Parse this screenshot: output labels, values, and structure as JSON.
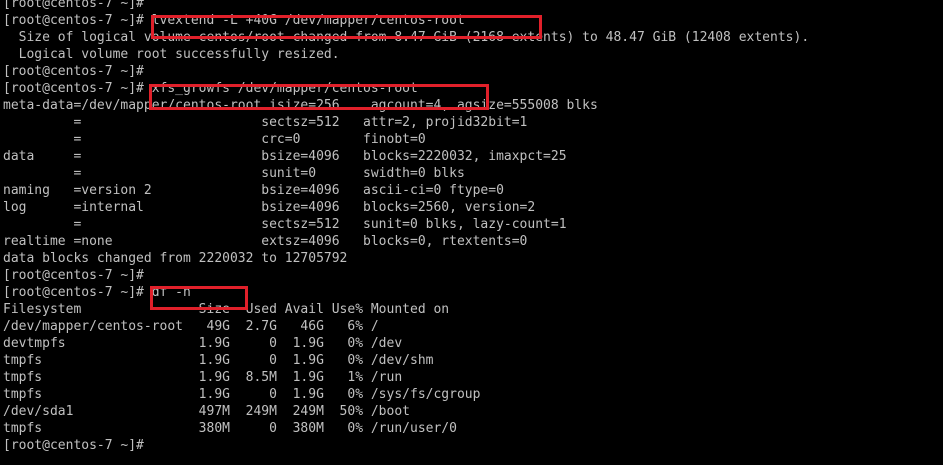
{
  "terminal": {
    "lines": [
      "[root@centos-7 ~]#",
      "[root@centos-7 ~]# lvextend -L +40G /dev/mapper/centos-root",
      "  Size of logical volume centos/root changed from 8.47 GiB (2168 extents) to 48.47 GiB (12408 extents).",
      "  Logical volume root successfully resized.",
      "[root@centos-7 ~]#",
      "[root@centos-7 ~]# xfs_growfs /dev/mapper/centos-root",
      "meta-data=/dev/mapper/centos-root isize=256    agcount=4, agsize=555008 blks",
      "         =                       sectsz=512   attr=2, projid32bit=1",
      "         =                       crc=0        finobt=0",
      "data     =                       bsize=4096   blocks=2220032, imaxpct=25",
      "         =                       sunit=0      swidth=0 blks",
      "naming   =version 2              bsize=4096   ascii-ci=0 ftype=0",
      "log      =internal               bsize=4096   blocks=2560, version=2",
      "         =                       sectsz=512   sunit=0 blks, lazy-count=1",
      "realtime =none                   extsz=4096   blocks=0, rtextents=0",
      "data blocks changed from 2220032 to 12705792",
      "[root@centos-7 ~]#",
      "[root@centos-7 ~]# df -h",
      "Filesystem               Size  Used Avail Use% Mounted on",
      "/dev/mapper/centos-root   49G  2.7G   46G   6% /",
      "devtmpfs                 1.9G     0  1.9G   0% /dev",
      "tmpfs                    1.9G     0  1.9G   0% /dev/shm",
      "tmpfs                    1.9G  8.5M  1.9G   1% /run",
      "tmpfs                    1.9G     0  1.9G   0% /sys/fs/cgroup",
      "/dev/sda1                497M  249M  249M  50% /boot",
      "tmpfs                    380M     0  380M   0% /run/user/0",
      "[root@centos-7 ~]# "
    ]
  },
  "colors": {
    "background": "#000000",
    "text": "#c0c0c0",
    "highlight": "#e0202a"
  }
}
